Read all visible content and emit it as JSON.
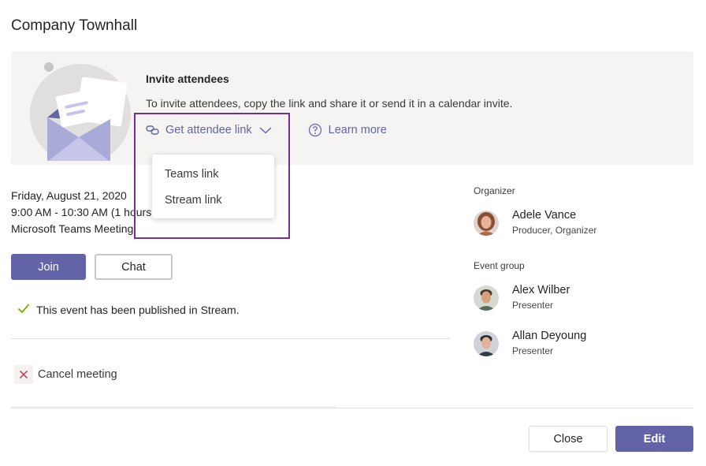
{
  "window": {
    "title": "Company Townhall"
  },
  "invite": {
    "heading": "Invite attendees",
    "description": "To invite attendees, copy the link and share it or send it in a calendar invite.",
    "get_link_label": "Get attendee link",
    "learn_more_label": "Learn more",
    "link_icon": "link-icon",
    "help_icon": "question-circle-icon",
    "dropdown_icon": "chevron-down-icon"
  },
  "dropdown": {
    "items": [
      {
        "label": "Teams link"
      },
      {
        "label": "Stream link"
      }
    ]
  },
  "event": {
    "date": "Friday, August 21, 2020",
    "time": "9:00 AM - 10:30 AM (1 hours",
    "type": "Microsoft Teams Meeting"
  },
  "actions": {
    "join_label": "Join",
    "chat_label": "Chat",
    "published_text": "This event has been published in Stream.",
    "cancel_label": "Cancel meeting"
  },
  "sidebar": {
    "organizer_label": "Organizer",
    "organizer": {
      "name": "Adele Vance",
      "role": "Producer, Organizer"
    },
    "event_group_label": "Event group",
    "members": [
      {
        "name": "Alex Wilber",
        "role": "Presenter"
      },
      {
        "name": "Allan Deyoung",
        "role": "Presenter"
      }
    ]
  },
  "footer": {
    "close_label": "Close",
    "edit_label": "Edit"
  },
  "colors": {
    "accent": "#6264a7",
    "highlight_border": "#7a2d90",
    "panel_bg": "#f5f4f3",
    "success": "#6bb700",
    "danger": "#c4314b"
  }
}
